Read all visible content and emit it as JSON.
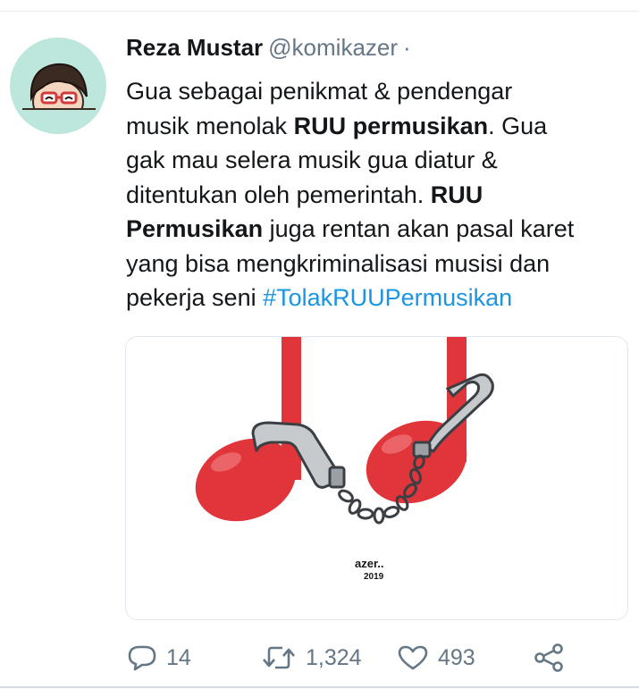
{
  "tweet": {
    "display_name": "Reza Mustar",
    "handle": "@komikazer",
    "separator": "·",
    "text": {
      "line1": "Gua sebagai penikmat & pendengar",
      "line2_a": "musik menolak ",
      "line2_bold": "RUU permusikan",
      "line2_b": ". Gua",
      "line3": "gak mau selera musik gua diatur &",
      "line4_a": "ditentukan oleh pemerintah. ",
      "line4_bold": "RUU",
      "line5_bold": "Permusikan",
      "line5_a": " juga rentan akan pasal karet",
      "line6": "yang bisa mengkriminalisasi musisi dan",
      "line7_a": "pekerja seni ",
      "hashtag": "#TolakRUUPermusikan"
    },
    "media": {
      "signature": "azer..",
      "signature_year": "2019"
    },
    "actions": {
      "reply_count": "14",
      "retweet_count": "1,324",
      "like_count": "493"
    }
  },
  "colors": {
    "hashtag": "#1b95e0",
    "meta_gray": "#657786",
    "avatar_bg": "#bde7dc",
    "note_red": "#e0353a"
  },
  "icons": [
    "reply-icon",
    "retweet-icon",
    "like-icon",
    "share-icon"
  ]
}
